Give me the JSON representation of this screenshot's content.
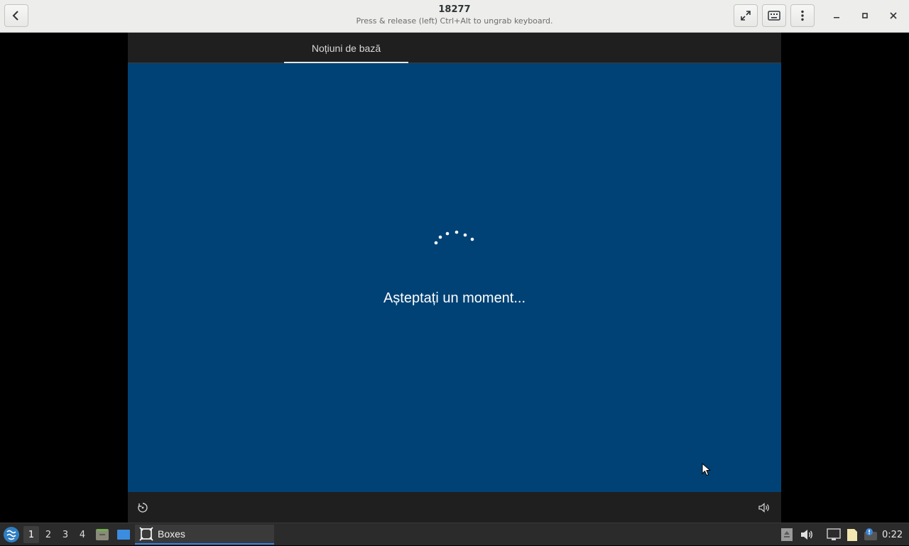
{
  "window": {
    "title": "18277",
    "subtitle": "Press & release (left) Ctrl+Alt to ungrab keyboard.",
    "icons": [
      "back-arrow-icon",
      "fullscreen-icon",
      "keyboard-icon",
      "kebab-menu-icon",
      "minimize-icon",
      "maximize-icon",
      "close-icon"
    ]
  },
  "vm": {
    "tab_label": "Noțiuni de bază",
    "status_text": "Așteptați un moment...",
    "background_color": "#004275",
    "bar_color": "#1f1f1f"
  },
  "taskbar": {
    "workspaces": [
      "1",
      "2",
      "3",
      "4"
    ],
    "active_workspace": "1",
    "task_label": "Boxes",
    "clock": "0:22",
    "accent_color": "#3584e4"
  }
}
